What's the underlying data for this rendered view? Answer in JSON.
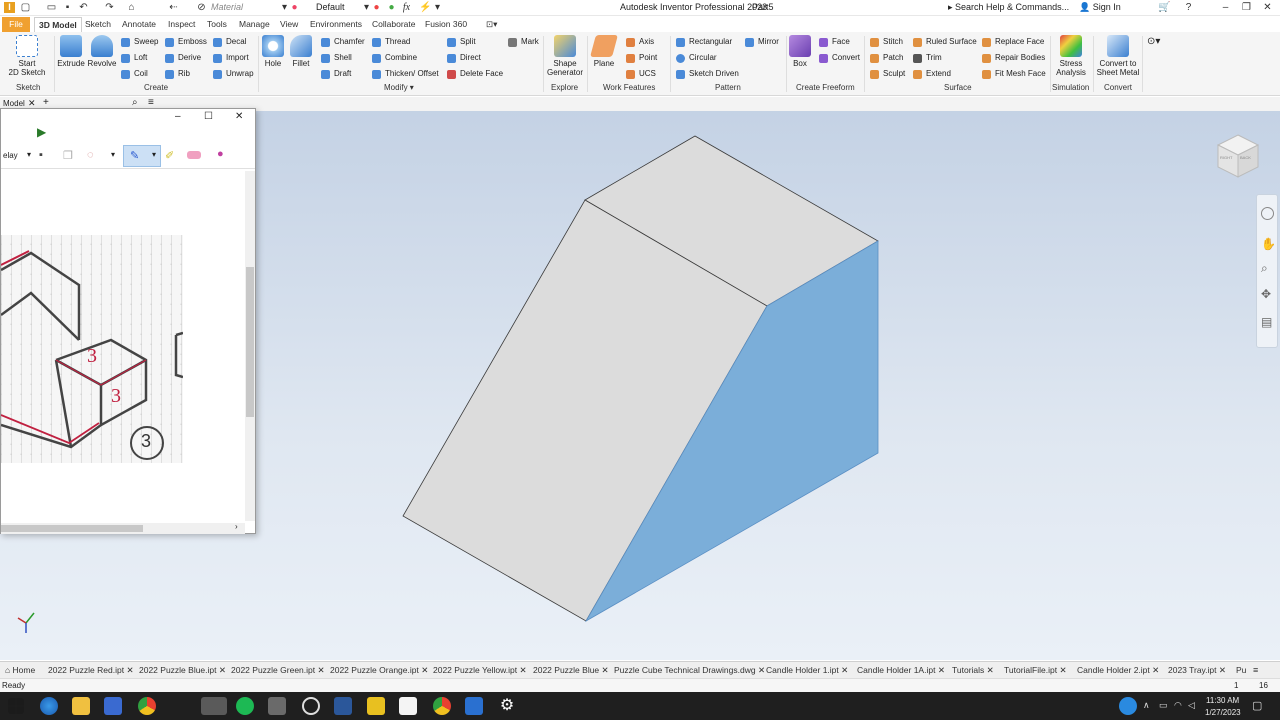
{
  "app": {
    "title": "Autodesk Inventor Professional 2023",
    "document": "Part5",
    "material_placeholder": "Material",
    "appearance": "Default",
    "search": "Search Help & Commands...",
    "signin": "Sign In"
  },
  "tabs": [
    "File",
    "3D Model",
    "Sketch",
    "Annotate",
    "Inspect",
    "Tools",
    "Manage",
    "View",
    "Environments",
    "Collaborate",
    "Fusion 360"
  ],
  "ribbon": {
    "sketch": {
      "start": "Start",
      "start2": "2D Sketch",
      "panel": "Sketch"
    },
    "create": {
      "extrude": "Extrude",
      "revolve": "Revolve",
      "sweep": "Sweep",
      "loft": "Loft",
      "coil": "Coil",
      "emboss": "Emboss",
      "derive": "Derive",
      "rib": "Rib",
      "decal": "Decal",
      "import": "Import",
      "unwrap": "Unwrap",
      "panel": "Create"
    },
    "modify": {
      "hole": "Hole",
      "fillet": "Fillet",
      "chamfer": "Chamfer",
      "shell": "Shell",
      "draft": "Draft",
      "thread": "Thread",
      "combine": "Combine",
      "thicken": "Thicken/ Offset",
      "split": "Split",
      "direct": "Direct",
      "deleteface": "Delete Face",
      "panel": "Modify"
    },
    "mark": "Mark",
    "explore": {
      "shape1": "Shape",
      "shape2": "Generator",
      "panel": "Explore"
    },
    "work": {
      "plane": "Plane",
      "axis": "Axis",
      "point": "Point",
      "ucs": "UCS",
      "panel": "Work Features"
    },
    "pattern": {
      "rect": "Rectangular",
      "circ": "Circular",
      "sketchdriven": "Sketch Driven",
      "mirror": "Mirror",
      "panel": "Pattern"
    },
    "freeform": {
      "box": "Box",
      "face": "Face",
      "convert": "Convert",
      "panel": "Create Freeform"
    },
    "surface": {
      "stitch": "Stitch",
      "patch": "Patch",
      "sculpt": "Sculpt",
      "ruled": "Ruled Surface",
      "trim": "Trim",
      "extend": "Extend",
      "replace": "Replace Face",
      "repair": "Repair Bodies",
      "fitmesh": "Fit Mesh Face",
      "panel": "Surface"
    },
    "simulation": {
      "stress1": "Stress",
      "stress2": "Analysis",
      "panel": "Simulation"
    },
    "convert": {
      "sm1": "Convert to",
      "sm2": "Sheet Metal",
      "panel": "Convert"
    }
  },
  "browser": {
    "tab": "Model"
  },
  "snip": {
    "delay": "elay",
    "numbers": [
      "3",
      "3",
      "3"
    ]
  },
  "viewcube": {
    "labels": [
      "RIGHT",
      "BACK"
    ]
  },
  "doc_tabs": [
    "Home",
    "2022 Puzzle Red.ipt",
    "2022 Puzzle Blue.ipt",
    "2022 Puzzle Green.ipt",
    "2022 Puzzle Orange.ipt",
    "2022 Puzzle Yellow.ipt",
    "2022 Puzzle Blue",
    "Puzzle Cube Technical Drawings.dwg",
    "Candle Holder 1.ipt",
    "Candle Holder 1A.ipt",
    "Tutorials",
    "TutorialFile.ipt",
    "Candle Holder 2.ipt",
    "2023 Tray.ipt",
    "Pu"
  ],
  "status": {
    "text": "Ready",
    "n1": "1",
    "n2": "16"
  },
  "clock": {
    "time": "11:30 AM",
    "date": "1/27/2023"
  },
  "colors": {
    "accent": "#f0a030",
    "face_blue": "#7baed9",
    "face_grey": "#dcdcdc"
  }
}
